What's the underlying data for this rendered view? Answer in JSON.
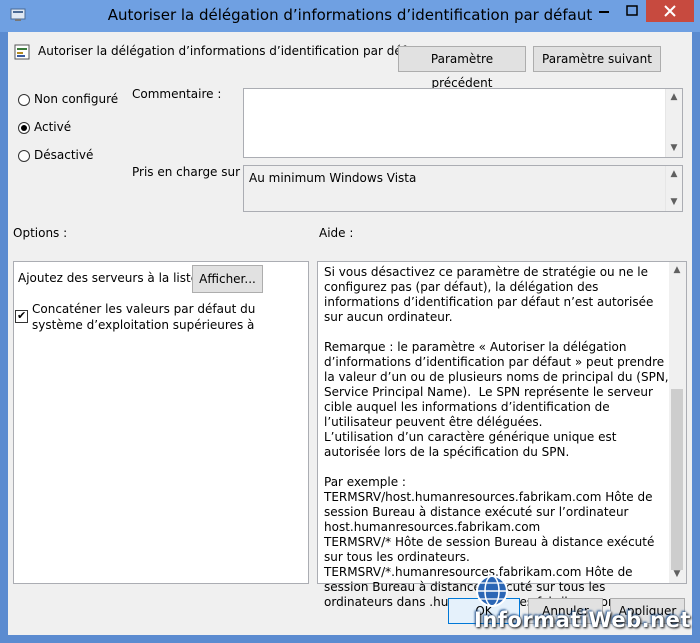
{
  "window": {
    "title": "Autoriser la délégation d’informations d’identification par défaut",
    "accent": "#6fa0e2",
    "close_color": "#c74a3f"
  },
  "header": {
    "policy_name": "Autoriser la délégation d’informations d’identification par défaut",
    "prev_button": "Paramètre précédent",
    "next_button": "Paramètre suivant"
  },
  "state": {
    "options": [
      {
        "label": "Non configuré",
        "selected": false
      },
      {
        "label": "Activé",
        "selected": true
      },
      {
        "label": "Désactivé",
        "selected": false
      }
    ]
  },
  "comment": {
    "label": "Commentaire :",
    "value": ""
  },
  "supported": {
    "label": "Pris en charge sur :",
    "value": "Au minimum Windows Vista"
  },
  "options_section": {
    "title": "Options :",
    "add_servers_label": "Ajoutez des serveurs à la liste :",
    "show_button": "Afficher...",
    "concat_checked": true,
    "concat_label": "Concaténer les valeurs par défaut du système d’exploitation supérieures à"
  },
  "help_section": {
    "title": "Aide :",
    "text": "Si vous désactivez ce paramètre de stratégie ou ne le configurez pas (par défaut), la délégation des informations d’identification par défaut n’est autorisée sur aucun ordinateur.\n\nRemarque : le paramètre « Autoriser la délégation d’informations d’identification par défaut » peut prendre la valeur d’un ou de plusieurs noms de principal du (SPN, Service Principal Name).  Le SPN représente le serveur cible auquel les informations d’identification de l’utilisateur peuvent être déléguées.\nL’utilisation d’un caractère générique unique est autorisée lors de la spécification du SPN.\n\nPar exemple :\nTERMSRV/host.humanresources.fabrikam.com Hôte de session Bureau à distance exécuté sur l’ordinateur host.humanresources.fabrikam.com\nTERMSRV/* Hôte de session Bureau à distance exécuté sur tous les ordinateurs.\nTERMSRV/*.humanresources.fabrikam.com Hôte de session Bureau à distance exécuté sur tous les ordinateurs dans .humanresources.fabrikam.com"
  },
  "footer": {
    "ok": "OK",
    "cancel": "Annuler",
    "apply": "Appliquer"
  },
  "watermark": {
    "text": "InformatiWeb.net"
  }
}
